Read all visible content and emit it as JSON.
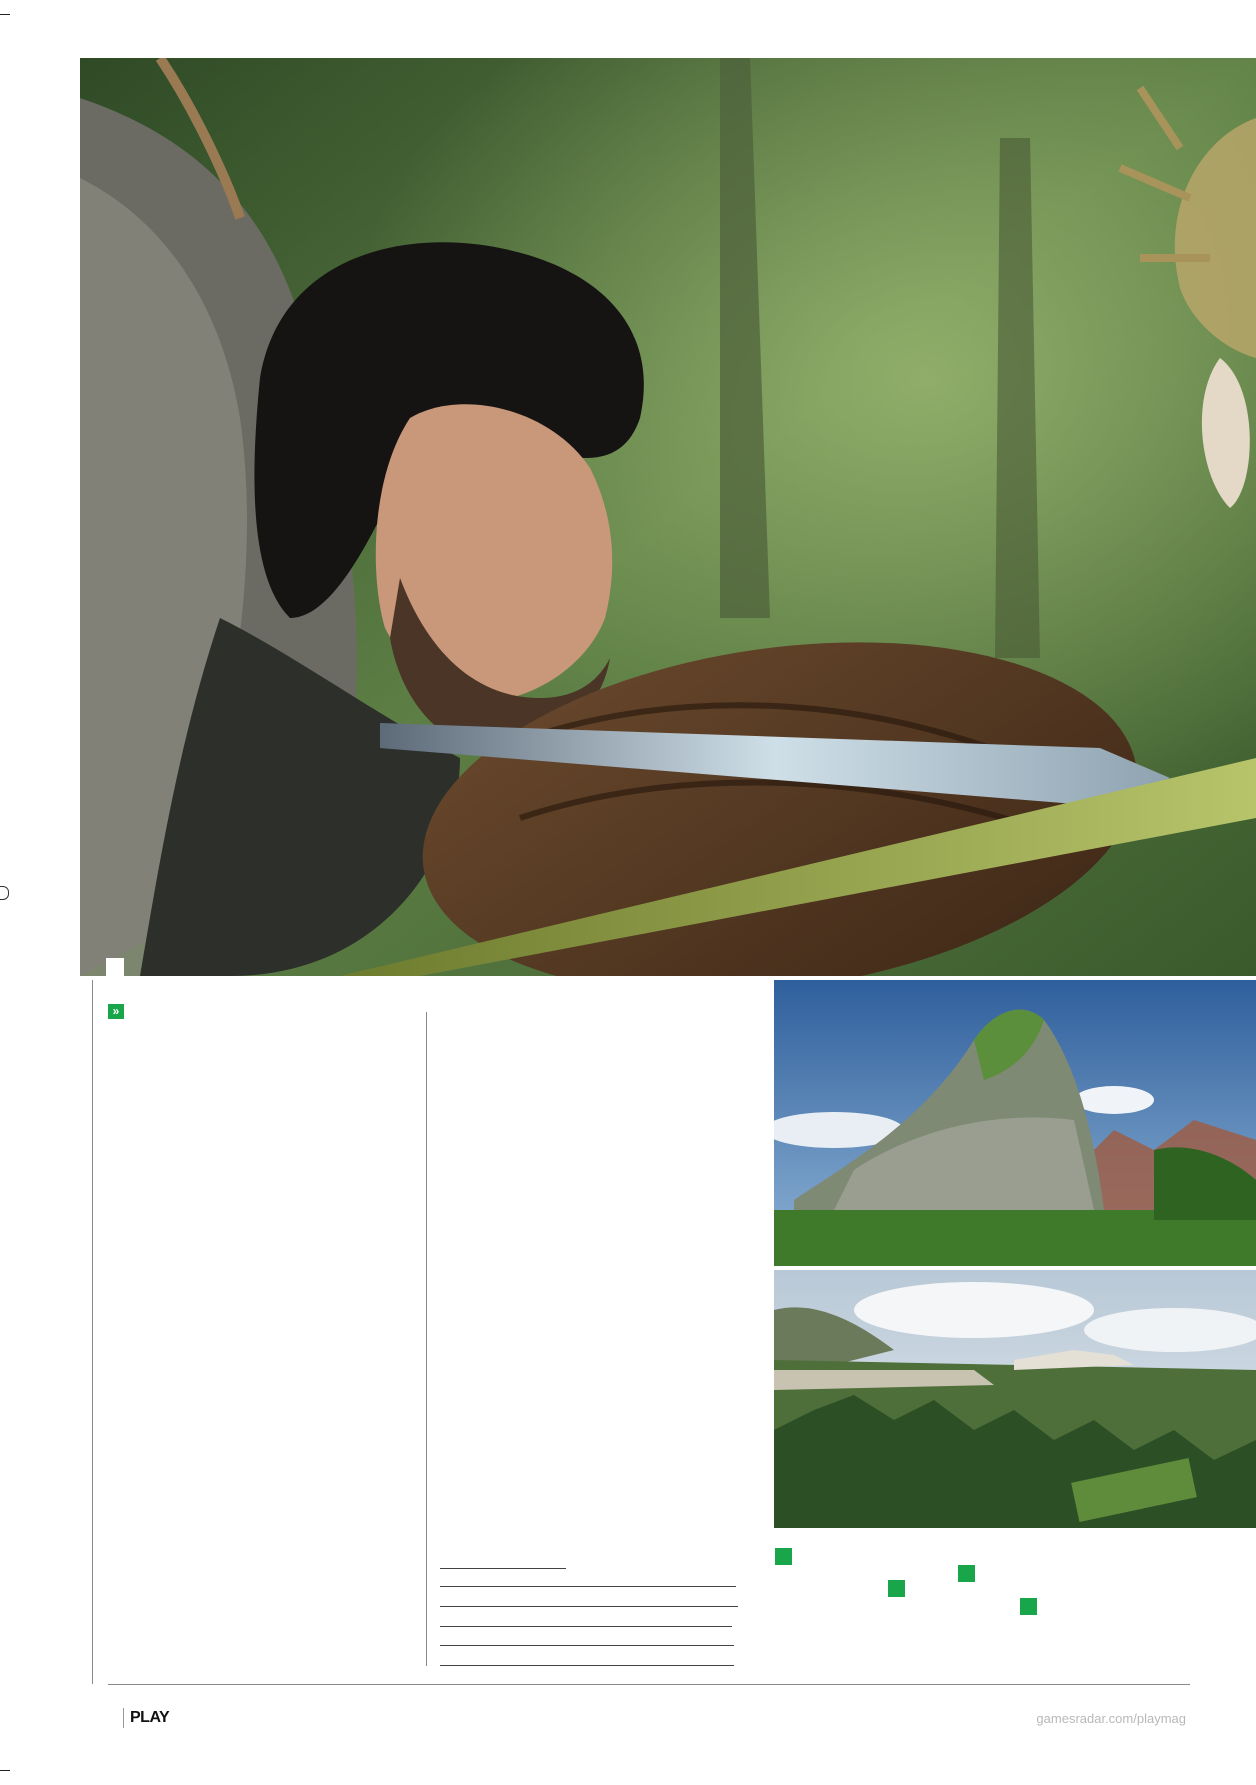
{
  "page": {
    "brand_label": "PLAY",
    "website": "gamesradar.com/playmag"
  },
  "images": {
    "hero": {
      "description_icon": "hero-screenshot-image"
    },
    "screenshot_top": {
      "description_icon": "rock-landscape-image"
    },
    "screenshot_bottom": {
      "description_icon": "town-landscape-image"
    }
  },
  "colors": {
    "accent_green": "#19a64a",
    "footer_grey": "#b8b8b8"
  },
  "icons": {
    "intro_marker": "double-chevron-icon",
    "caption_markers": "green-square-icon"
  }
}
